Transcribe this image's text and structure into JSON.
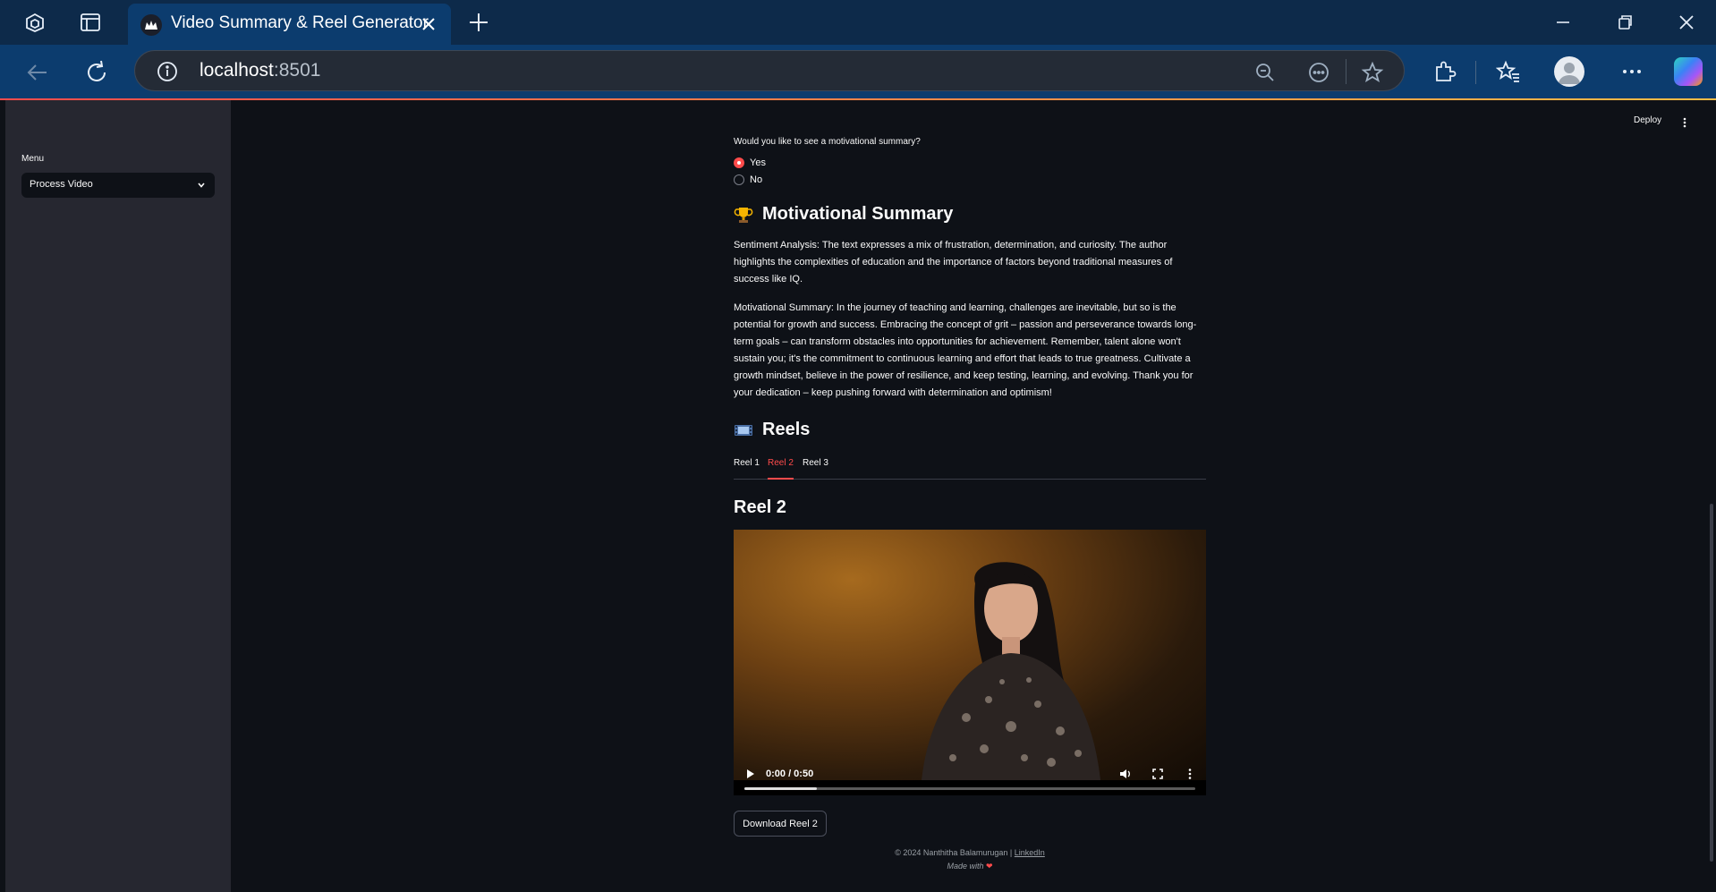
{
  "browser": {
    "tab_title": "Video Summary & Reel Generator",
    "url_host": "localhost",
    "url_port": ":8501",
    "icons": [
      "workspaces-icon",
      "tab-actions-icon",
      "streamlit-favicon",
      "close-icon",
      "new-tab-icon",
      "minimize-icon",
      "restore-icon",
      "close-window-icon",
      "back-icon",
      "refresh-icon",
      "site-info-icon",
      "zoom-out-icon",
      "read-aloud-icon",
      "favorite-star-icon",
      "extensions-icon",
      "favorites-icon",
      "profile-icon",
      "more-icon",
      "copilot-icon"
    ]
  },
  "sidebar": {
    "menu_label": "Menu",
    "menu_value": "Process Video"
  },
  "header": {
    "deploy_label": "Deploy"
  },
  "main": {
    "question": "Would you like to see a motivational summary?",
    "options": [
      "Yes",
      "No"
    ],
    "selected_option": "Yes",
    "summary_heading": "Motivational Summary",
    "sentiment_text": "Sentiment Analysis: The text expresses a mix of frustration, determination, and curiosity. The author highlights the complexities of education and the importance of factors beyond traditional measures of success like IQ.",
    "motivational_text": "Motivational Summary: In the journey of teaching and learning, challenges are inevitable, but so is the potential for growth and success. Embracing the concept of grit – passion and perseverance towards long-term goals – can transform obstacles into opportunities for achievement. Remember, talent alone won't sustain you; it's the commitment to continuous learning and effort that leads to true greatness. Cultivate a growth mindset, believe in the power of resilience, and keep testing, learning, and evolving. Thank you for your dedication – keep pushing forward with determination and optimism!",
    "reels_heading": "Reels",
    "tabs": [
      "Reel 1",
      "Reel 2",
      "Reel 3"
    ],
    "active_tab": "Reel 2",
    "reel_title": "Reel 2",
    "video": {
      "time": "0:00 / 0:50",
      "buffered_fraction": 0.16
    },
    "download_label": "Download Reel 2"
  },
  "footer": {
    "copyright": "© 2024 Nanthitha Balamurugan | ",
    "link": "LinkedIn",
    "made_with": "Made with "
  },
  "colors": {
    "accent": "#ff4b4b",
    "background": "#0e1117",
    "sidebar": "#262730",
    "browser_frame": "#0c3c6e"
  }
}
